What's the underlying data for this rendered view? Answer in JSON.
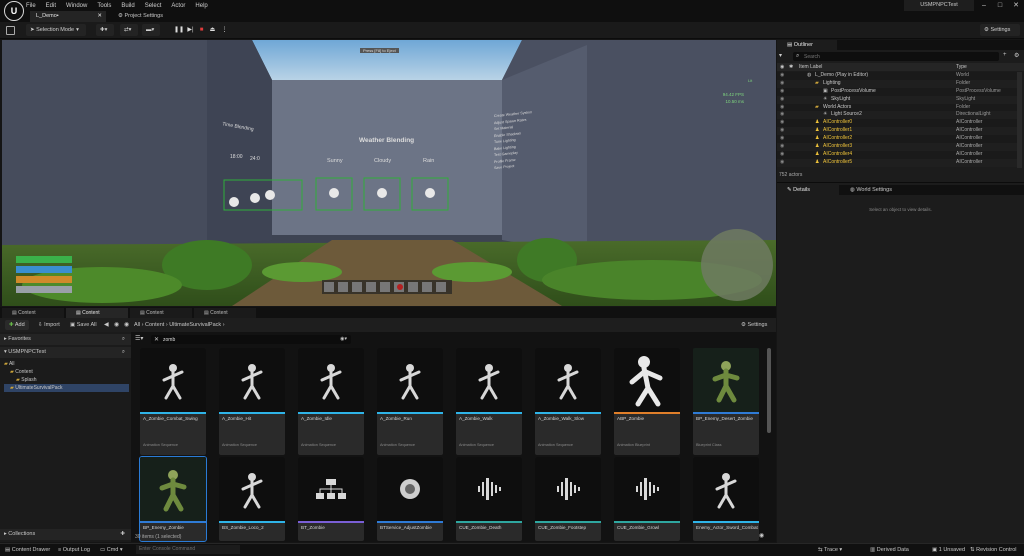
{
  "app": {
    "title": "USMPNPCTest",
    "level_tab": "L_Demo•",
    "project_settings": "Project Settings"
  },
  "menu": [
    "File",
    "Edit",
    "Window",
    "Tools",
    "Build",
    "Select",
    "Actor",
    "Help"
  ],
  "toolbar": {
    "selection_mode": "Selection Mode",
    "settings": "Settings"
  },
  "viewport": {
    "weather_title": "Weather Blending",
    "weather_options": [
      "Sunny",
      "Cloudy",
      "Rain"
    ],
    "time_label": "Time Blending",
    "time_values": [
      "18:00",
      "24:0"
    ],
    "fps": "94.42 FPS",
    "ms": "10.50 ms",
    "lit": "Lit",
    "wall_notes": [
      "Create Weather System",
      "Adjust Spawn Rates",
      "Set Material",
      "Enable Shadows",
      "Tune Lighting",
      "Bake Lighting",
      "Test Gameplay",
      "Profile Frame",
      "Save Project"
    ]
  },
  "outliner": {
    "title": "Outliner",
    "search_placeholder": "Search",
    "col_label": "Item Label",
    "col_type": "Type",
    "rows": [
      {
        "label": "L_Demo (Play in Editor)",
        "type": "World",
        "indent": 0,
        "icon": "world-icon"
      },
      {
        "label": "Lighting",
        "type": "Folder",
        "indent": 1,
        "icon": "folder-icon"
      },
      {
        "label": "PostProcessVolume",
        "type": "PostProcessVolume",
        "indent": 2,
        "icon": "volume-icon"
      },
      {
        "label": "SkyLight",
        "type": "SkyLight",
        "indent": 2,
        "icon": "light-icon"
      },
      {
        "label": "World Actors",
        "type": "Folder",
        "indent": 1,
        "icon": "folder-icon"
      },
      {
        "label": "Light Source2",
        "type": "DirectionalLight",
        "indent": 2,
        "icon": "light-icon"
      },
      {
        "label": "AIController0",
        "type": "AIController",
        "indent": 1,
        "icon": "controller-icon"
      },
      {
        "label": "AIController1",
        "type": "AIController",
        "indent": 1,
        "icon": "controller-icon"
      },
      {
        "label": "AIController2",
        "type": "AIController",
        "indent": 1,
        "icon": "controller-icon"
      },
      {
        "label": "AIController3",
        "type": "AIController",
        "indent": 1,
        "icon": "controller-icon"
      },
      {
        "label": "AIController4",
        "type": "AIController",
        "indent": 1,
        "icon": "controller-icon"
      },
      {
        "label": "AIController5",
        "type": "AIController",
        "indent": 1,
        "icon": "controller-icon"
      }
    ],
    "count": "752 actors"
  },
  "details": {
    "tab1": "Details",
    "tab2": "World Settings",
    "empty": "Select an object to view details."
  },
  "content_browser": {
    "tabs": [
      "Content Browse...",
      "Content Browse...",
      "Content Browse...",
      "Content Browse..."
    ],
    "add": "Add",
    "import": "Import",
    "save_all": "Save All",
    "path": [
      "All",
      "Content",
      "UltimateSurvivalPack"
    ],
    "settings": "Settings",
    "favorites": "Favorites",
    "project": "USMPNPCTest",
    "tree": [
      {
        "label": "All",
        "indent": 0
      },
      {
        "label": "Content",
        "indent": 1
      },
      {
        "label": "Splash",
        "indent": 2
      },
      {
        "label": "UltimateSurvivalPack",
        "indent": 1
      }
    ],
    "collections": "Collections",
    "search_value": "zomb",
    "status": "30 items (1 selected)",
    "assets": [
      {
        "name": "A_Zombie_Combat_Swing",
        "type": "Animation Sequence",
        "bar": "#2fb4e8",
        "thumb": "figure"
      },
      {
        "name": "A_Zombie_Hit",
        "type": "Animation Sequence",
        "bar": "#2fb4e8",
        "thumb": "figure"
      },
      {
        "name": "A_Zombie_Idle",
        "type": "Animation Sequence",
        "bar": "#2fb4e8",
        "thumb": "figure"
      },
      {
        "name": "A_Zombie_Run",
        "type": "Animation Sequence",
        "bar": "#2fb4e8",
        "thumb": "figure"
      },
      {
        "name": "A_Zombie_Walk",
        "type": "Animation Sequence",
        "bar": "#2fb4e8",
        "thumb": "figure"
      },
      {
        "name": "A_Zombie_Walk_Slow",
        "type": "Animation Sequence",
        "bar": "#2fb4e8",
        "thumb": "figure"
      },
      {
        "name": "ABP_Zombie",
        "type": "Animation Blueprint",
        "bar": "#e07f2a",
        "thumb": "figure-big"
      },
      {
        "name": "BP_Enemy_Desert_Zombie",
        "type": "Blueprint Class",
        "bar": "#2f7bd6",
        "thumb": "zombie"
      },
      {
        "name": "BP_Enemy_Zombie",
        "type": "",
        "bar": "#2f7bd6",
        "thumb": "zombie"
      },
      {
        "name": "BS_Zombie_Loco_2",
        "type": "",
        "bar": "#2fb4e8",
        "thumb": "figure"
      },
      {
        "name": "BT_Zombie",
        "type": "",
        "bar": "#7a5fd6",
        "thumb": "tree"
      },
      {
        "name": "BTService_AdjustZombie",
        "type": "",
        "bar": "#2f7bd6",
        "thumb": "sphere"
      },
      {
        "name": "CUE_Zombie_Death",
        "type": "",
        "bar": "#2fa7a0",
        "thumb": "sound"
      },
      {
        "name": "CUE_Zombie_Footstep",
        "type": "",
        "bar": "#2fa7a0",
        "thumb": "sound"
      },
      {
        "name": "CUE_Zombie_Growl",
        "type": "",
        "bar": "#2fa7a0",
        "thumb": "sound"
      },
      {
        "name": "Enemy_Actor_Sword_Combat",
        "type": "",
        "bar": "#2fb4e8",
        "thumb": "figure"
      }
    ]
  },
  "statusbar": {
    "content_drawer": "Content Drawer",
    "output_log": "Output Log",
    "cmd": "Cmd",
    "console_placeholder": "Enter Console Command",
    "trace": "Trace",
    "derived_data": "Derived Data",
    "unsaved": "1 Unsaved",
    "revision": "Revision Control"
  }
}
